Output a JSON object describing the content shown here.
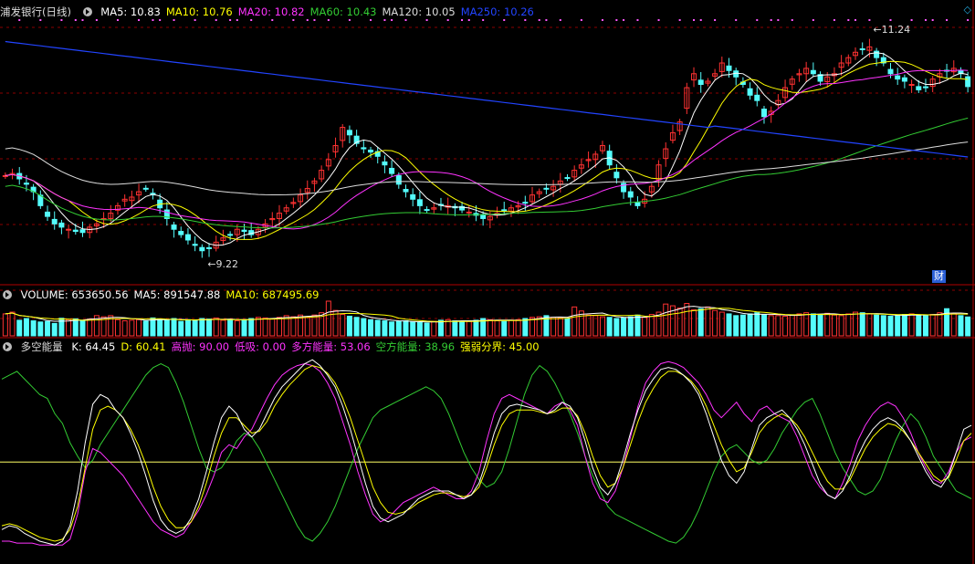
{
  "main_header": {
    "title": "浦发银行(日线)",
    "indicators": [
      {
        "label": "MA5: 10.83",
        "color": "#ffffff"
      },
      {
        "label": "MA10: 10.76",
        "color": "#ffff00"
      },
      {
        "label": "MA20: 10.82",
        "color": "#ff33ff"
      },
      {
        "label": "MA60: 10.43",
        "color": "#33cc33"
      },
      {
        "label": "MA120: 10.05",
        "color": "#dddddd"
      },
      {
        "label": "MA250: 10.26",
        "color": "#2244ff"
      }
    ]
  },
  "volume_header": {
    "indicators": [
      {
        "label": "VOLUME: 653650.56",
        "color": "#ffffff"
      },
      {
        "label": "MA5: 891547.88",
        "color": "#ffffff"
      },
      {
        "label": "MA10: 687495.69",
        "color": "#ffff00"
      }
    ]
  },
  "osc_header": {
    "title": "多空能量",
    "indicators": [
      {
        "label": "K: 64.45",
        "color": "#ffffff"
      },
      {
        "label": "D: 60.41",
        "color": "#ffff00"
      },
      {
        "label": "高抛: 90.00",
        "color": "#ff33ff"
      },
      {
        "label": "低吸: 0.00",
        "color": "#ff33ff"
      },
      {
        "label": "多方能量: 53.06",
        "color": "#ff33ff"
      },
      {
        "label": "空方能量: 38.96",
        "color": "#33cc33"
      },
      {
        "label": "强弱分界: 45.00",
        "color": "#ffff00"
      }
    ]
  },
  "annotations": {
    "low": "9.22",
    "high": "11.24",
    "fin_badge": "财",
    "corner_icon": "◇"
  },
  "colors": {
    "up": "#ff3232",
    "down": "#54fcfc",
    "grid": "#8b0000",
    "bg": "#000000"
  },
  "chart_data": {
    "type": "candlestick",
    "stock": "浦发银行",
    "period": "日线",
    "price_range": [
      9.0,
      11.45
    ],
    "closes": [
      10.0,
      10.02,
      9.97,
      9.92,
      9.85,
      9.72,
      9.62,
      9.55,
      9.52,
      9.5,
      9.48,
      9.47,
      9.52,
      9.55,
      9.6,
      9.65,
      9.72,
      9.78,
      9.8,
      9.85,
      9.88,
      9.82,
      9.7,
      9.6,
      9.5,
      9.45,
      9.4,
      9.35,
      9.3,
      9.32,
      9.38,
      9.42,
      9.45,
      9.5,
      9.48,
      9.45,
      9.5,
      9.55,
      9.6,
      9.65,
      9.7,
      9.75,
      9.82,
      9.88,
      9.95,
      10.05,
      10.15,
      10.28,
      10.45,
      10.38,
      10.3,
      10.25,
      10.22,
      10.18,
      10.1,
      10.02,
      9.92,
      9.85,
      9.78,
      9.72,
      9.68,
      9.7,
      9.73,
      9.72,
      9.7,
      9.68,
      9.66,
      9.63,
      9.6,
      9.62,
      9.65,
      9.68,
      9.7,
      9.72,
      9.75,
      9.82,
      9.85,
      9.88,
      9.9,
      9.95,
      9.98,
      10.05,
      10.1,
      10.15,
      10.2,
      10.28,
      10.1,
      9.98,
      9.85,
      9.8,
      9.72,
      9.78,
      9.9,
      10.1,
      10.25,
      10.4,
      10.5,
      10.82,
      10.95,
      10.85,
      10.88,
      10.95,
      11.05,
      10.98,
      10.92,
      10.85,
      10.75,
      10.7,
      10.55,
      10.6,
      10.7,
      10.82,
      10.9,
      10.95,
      11.0,
      10.95,
      10.88,
      10.92,
      10.95,
      11.05,
      11.1,
      11.15,
      11.18,
      11.2,
      11.1,
      11.05,
      10.95,
      10.9,
      10.88,
      10.85,
      10.8,
      10.82,
      10.9,
      10.95,
      10.98,
      11.0,
      10.95,
      10.83
    ],
    "volume": [
      760000,
      820000,
      540000,
      600000,
      520000,
      480000,
      500000,
      430000,
      610000,
      560000,
      590000,
      540000,
      580000,
      700000,
      660000,
      700000,
      560000,
      520000,
      540000,
      560000,
      510000,
      620000,
      580000,
      540000,
      600000,
      500000,
      560000,
      520000,
      600000,
      580000,
      620000,
      540000,
      560000,
      520000,
      560000,
      600000,
      640000,
      620000,
      580000,
      640000,
      700000,
      660000,
      720000,
      660000,
      720000,
      800000,
      1200000,
      880000,
      740000,
      680000,
      640000,
      600000,
      560000,
      540000,
      520000,
      480000,
      500000,
      520000,
      480000,
      460000,
      440000,
      500000,
      540000,
      560000,
      520000,
      480000,
      500000,
      540000,
      600000,
      560000,
      520000,
      500000,
      540000,
      560000,
      600000,
      640000,
      660000,
      700000,
      640000,
      620000,
      600000,
      1000000,
      860000,
      720000,
      700000,
      660000,
      640000,
      600000,
      620000,
      660000,
      720000,
      640000,
      740000,
      820000,
      1100000,
      1040000,
      960000,
      1120000,
      900000,
      940000,
      1000000,
      880000,
      820000,
      760000,
      700000,
      720000,
      760000,
      800000,
      740000,
      700000,
      700000,
      680000,
      720000,
      760000,
      800000,
      760000,
      740000,
      780000,
      720000,
      700000,
      760000,
      820000,
      800000,
      760000,
      720000,
      700000,
      680000,
      700000,
      740000,
      760000,
      720000,
      700000,
      740000,
      800000,
      940000,
      760000,
      700000,
      653650
    ],
    "osc_reference_lines": {
      "high": 90,
      "low": 0,
      "mid": 45
    },
    "osc_range": [
      -5,
      100
    ],
    "k": [
      10,
      12,
      11,
      8,
      6,
      4,
      3,
      2,
      4,
      12,
      30,
      55,
      75,
      80,
      78,
      72,
      68,
      60,
      50,
      38,
      25,
      15,
      10,
      8,
      10,
      16,
      26,
      40,
      55,
      68,
      74,
      70,
      62,
      58,
      62,
      70,
      78,
      84,
      88,
      92,
      96,
      98,
      95,
      90,
      84,
      74,
      62,
      48,
      34,
      22,
      16,
      14,
      16,
      18,
      22,
      26,
      28,
      30,
      30,
      30,
      28,
      26,
      28,
      34,
      46,
      60,
      70,
      74,
      75,
      74,
      73,
      72,
      70,
      72,
      76,
      74,
      68,
      56,
      42,
      32,
      28,
      34,
      46,
      60,
      72,
      82,
      88,
      93,
      94,
      93,
      90,
      86,
      80,
      70,
      58,
      46,
      38,
      34,
      40,
      52,
      64,
      68,
      70,
      72,
      68,
      62,
      54,
      44,
      34,
      28,
      26,
      30,
      38,
      48,
      56,
      62,
      66,
      68,
      66,
      62,
      56,
      48,
      40,
      34,
      32,
      38,
      50,
      62,
      64
    ],
    "d": [
      12,
      13,
      12,
      10,
      8,
      6,
      5,
      4,
      5,
      10,
      22,
      42,
      62,
      72,
      74,
      72,
      68,
      62,
      54,
      44,
      32,
      22,
      15,
      11,
      11,
      14,
      22,
      34,
      48,
      60,
      68,
      68,
      64,
      60,
      61,
      66,
      74,
      80,
      85,
      89,
      93,
      95,
      94,
      91,
      86,
      78,
      68,
      56,
      44,
      32,
      24,
      19,
      18,
      19,
      21,
      24,
      26,
      28,
      29,
      29,
      28,
      27,
      28,
      32,
      42,
      54,
      64,
      70,
      72,
      72,
      72,
      71,
      70,
      71,
      73,
      73,
      69,
      60,
      48,
      38,
      32,
      34,
      42,
      54,
      66,
      76,
      83,
      89,
      92,
      92,
      90,
      87,
      82,
      74,
      64,
      54,
      46,
      40,
      42,
      50,
      60,
      65,
      68,
      70,
      68,
      64,
      58,
      50,
      42,
      35,
      31,
      31,
      36,
      44,
      52,
      58,
      62,
      65,
      64,
      61,
      56,
      50,
      44,
      38,
      35,
      37,
      46,
      56,
      60
    ],
    "long_energy": [
      4,
      4,
      3,
      3,
      3,
      2,
      2,
      2,
      2,
      5,
      18,
      40,
      52,
      50,
      46,
      42,
      38,
      32,
      26,
      20,
      14,
      10,
      8,
      6,
      8,
      14,
      20,
      28,
      38,
      50,
      54,
      52,
      58,
      62,
      70,
      78,
      85,
      90,
      93,
      95,
      96,
      95,
      92,
      86,
      78,
      66,
      54,
      40,
      28,
      18,
      14,
      16,
      20,
      24,
      26,
      28,
      30,
      32,
      30,
      28,
      26,
      26,
      30,
      40,
      56,
      70,
      78,
      80,
      78,
      76,
      74,
      72,
      70,
      74,
      76,
      72,
      64,
      48,
      34,
      26,
      24,
      30,
      42,
      58,
      74,
      86,
      92,
      96,
      97,
      96,
      94,
      90,
      86,
      80,
      72,
      68,
      72,
      76,
      70,
      66,
      72,
      74,
      70,
      68,
      66,
      58,
      48,
      38,
      32,
      28,
      26,
      34,
      44,
      56,
      64,
      70,
      74,
      76,
      74,
      68,
      60,
      50,
      42,
      36,
      34,
      40,
      50,
      56,
      58
    ],
    "short_energy": [
      88,
      90,
      92,
      88,
      84,
      80,
      78,
      70,
      65,
      55,
      48,
      42,
      46,
      54,
      60,
      66,
      72,
      78,
      84,
      90,
      94,
      96,
      94,
      86,
      76,
      64,
      52,
      42,
      40,
      42,
      48,
      56,
      60,
      58,
      52,
      44,
      36,
      28,
      20,
      12,
      6,
      4,
      8,
      14,
      22,
      32,
      42,
      52,
      60,
      68,
      72,
      74,
      76,
      78,
      80,
      82,
      84,
      82,
      78,
      70,
      60,
      50,
      42,
      36,
      32,
      34,
      40,
      52,
      66,
      80,
      90,
      95,
      92,
      86,
      78,
      70,
      60,
      48,
      38,
      30,
      22,
      18,
      16,
      14,
      12,
      10,
      8,
      6,
      4,
      3,
      6,
      12,
      20,
      30,
      40,
      48,
      52,
      54,
      50,
      46,
      44,
      46,
      52,
      60,
      66,
      72,
      76,
      78,
      70,
      60,
      50,
      42,
      36,
      30,
      28,
      30,
      36,
      46,
      56,
      64,
      70,
      66,
      58,
      48,
      42,
      36,
      30,
      28,
      26
    ]
  }
}
